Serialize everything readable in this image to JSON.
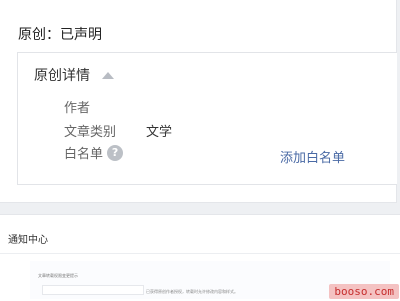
{
  "original": {
    "status_text": "原创：已声明",
    "details": {
      "title": "原创详情",
      "author_label": "作者",
      "category_label": "文章类别",
      "category_value": "文学",
      "whitelist_label": "白名单",
      "help_glyph": "?",
      "add_whitelist_label": "添加白名单"
    }
  },
  "notice": {
    "title": "通知中心",
    "message_title": "文章转载权限变更提示",
    "message_prefix": "文章：",
    "message_suffix": "已获得原创作者授权，转载时允许修改内容和样式。"
  },
  "watermark": {
    "text": "booso.com"
  },
  "colors": {
    "link": "#4a6aa5",
    "page_bg": "#eef0f3",
    "watermark_bg": "#f4c2c2",
    "watermark_text": "#c62d2d"
  },
  "icons": {
    "collapse": "caret-up-icon",
    "help": "help-icon"
  }
}
